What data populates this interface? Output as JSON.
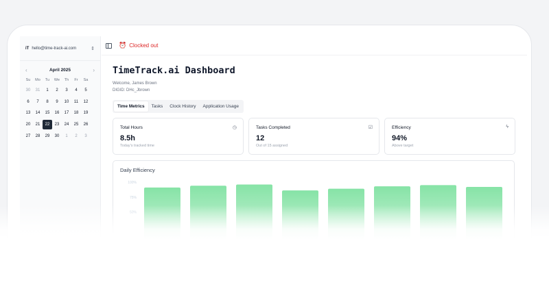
{
  "account": {
    "logo": "iT",
    "email": "hello@time-track-ai.com",
    "switch_icon": "chevrons-up-down-icon"
  },
  "calendar": {
    "month": "April 2025",
    "weekdays": [
      "Su",
      "Mo",
      "Tu",
      "We",
      "Th",
      "Fr",
      "Sa"
    ],
    "days": [
      {
        "d": "30",
        "muted": true
      },
      {
        "d": "31",
        "muted": true
      },
      {
        "d": "1"
      },
      {
        "d": "2"
      },
      {
        "d": "3"
      },
      {
        "d": "4"
      },
      {
        "d": "5"
      },
      {
        "d": "6"
      },
      {
        "d": "7"
      },
      {
        "d": "8"
      },
      {
        "d": "9"
      },
      {
        "d": "10"
      },
      {
        "d": "11"
      },
      {
        "d": "12"
      },
      {
        "d": "13"
      },
      {
        "d": "14"
      },
      {
        "d": "15"
      },
      {
        "d": "16"
      },
      {
        "d": "17"
      },
      {
        "d": "18"
      },
      {
        "d": "19"
      },
      {
        "d": "20"
      },
      {
        "d": "21"
      },
      {
        "d": "22",
        "selected": true
      },
      {
        "d": "23"
      },
      {
        "d": "24"
      },
      {
        "d": "25"
      },
      {
        "d": "26"
      },
      {
        "d": "27"
      },
      {
        "d": "28"
      },
      {
        "d": "29"
      },
      {
        "d": "30"
      },
      {
        "d": "1",
        "muted": true
      },
      {
        "d": "2",
        "muted": true
      },
      {
        "d": "3",
        "muted": true
      }
    ]
  },
  "topbar": {
    "status": "Clocked out",
    "status_color": "#dc2626"
  },
  "header": {
    "title": "TimeTrack.ai Dashboard",
    "welcome": "Welcome, James Brown",
    "digid": "DIGID: DHc_Jbrown"
  },
  "tabs": [
    {
      "label": "Time Metrics",
      "active": true
    },
    {
      "label": "Tasks"
    },
    {
      "label": "Clock History"
    },
    {
      "label": "Application Usage"
    }
  ],
  "cards": [
    {
      "label": "Total Hours",
      "value": "8.5h",
      "sub": "Today's tracked time",
      "icon": "clock-icon"
    },
    {
      "label": "Tasks Completed",
      "value": "12",
      "sub": "Out of 15 assigned",
      "icon": "check-square-icon"
    },
    {
      "label": "Efficiency",
      "value": "94%",
      "sub": "Above target",
      "icon": "bolt-icon"
    }
  ],
  "chart_data": {
    "type": "bar",
    "title": "Daily Efficiency",
    "yticks": [
      "100%",
      "75%",
      "50%"
    ],
    "ylim": [
      0,
      100
    ],
    "values": [
      91,
      94,
      96,
      86,
      89,
      93,
      95,
      92
    ],
    "bar_color": "#86e3a6"
  }
}
